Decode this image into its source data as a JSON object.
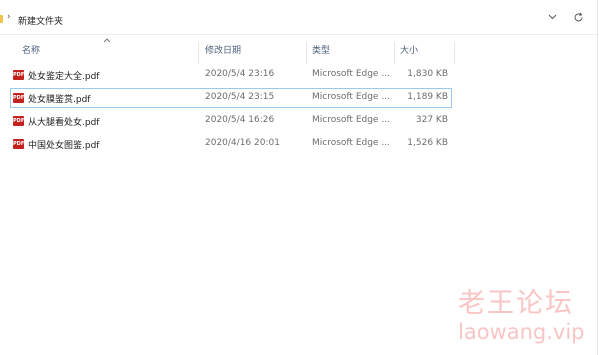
{
  "address_bar": {
    "path_segment": "新建文件夹",
    "chevron": "›",
    "dropdown_icon": "chevron-down",
    "refresh_icon": "refresh"
  },
  "columns": {
    "name": "名称",
    "modified": "修改日期",
    "type": "类型",
    "size": "大小"
  },
  "files": [
    {
      "name": "处女鉴定大全.pdf",
      "modified": "2020/5/4 23:16",
      "type": "Microsoft Edge ...",
      "size": "1,830 KB",
      "icon_label": "PDF"
    },
    {
      "name": "处女膜鉴赏.pdf",
      "modified": "2020/5/4 23:15",
      "type": "Microsoft Edge ...",
      "size": "1,189 KB",
      "icon_label": "PDF"
    },
    {
      "name": "从大腿看处女.pdf",
      "modified": "2020/5/4 16:26",
      "type": "Microsoft Edge ...",
      "size": "327 KB",
      "icon_label": "PDF"
    },
    {
      "name": "中国处女图鉴.pdf",
      "modified": "2020/4/16 20:01",
      "type": "Microsoft Edge ...",
      "size": "1,526 KB",
      "icon_label": "PDF"
    }
  ],
  "watermark": {
    "line1": "老王论坛",
    "line2": "laowang.vip"
  },
  "colors": {
    "pdf_icon": "#c5221f",
    "selection_border": "#99c9ef",
    "watermark": "#f05a5a",
    "header_text": "#4c607a"
  }
}
